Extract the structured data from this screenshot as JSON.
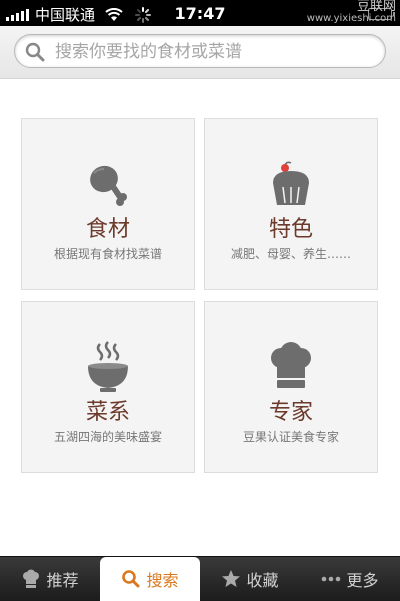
{
  "status_bar": {
    "carrier": "中国联通",
    "time": "17:47",
    "watermark": "豆联网",
    "watermark_sub": "www.yixieshi.com"
  },
  "search": {
    "placeholder": "搜索你要找的食材或菜谱"
  },
  "cards": [
    {
      "title": "食材",
      "subtitle": "根据现有食材找菜谱",
      "icon": "drumstick-icon"
    },
    {
      "title": "特色",
      "subtitle": "减肥、母婴、养生……",
      "icon": "cupcake-icon"
    },
    {
      "title": "菜系",
      "subtitle": "五湖四海的美味盛宴",
      "icon": "steaming-bowl-icon"
    },
    {
      "title": "专家",
      "subtitle": "豆果认证美食专家",
      "icon": "chef-hat-icon"
    }
  ],
  "tabs": [
    {
      "label": "推荐",
      "icon": "chef-hat-icon",
      "active": false
    },
    {
      "label": "搜索",
      "icon": "search-icon",
      "active": true
    },
    {
      "label": "收藏",
      "icon": "star-icon",
      "active": false
    },
    {
      "label": "更多",
      "icon": "more-dots-icon",
      "active": false
    }
  ],
  "colors": {
    "accent": "#d9781f",
    "title": "#6b3a2a",
    "icon_gray": "#6d6d6d",
    "icon_red": "#e0413a"
  }
}
